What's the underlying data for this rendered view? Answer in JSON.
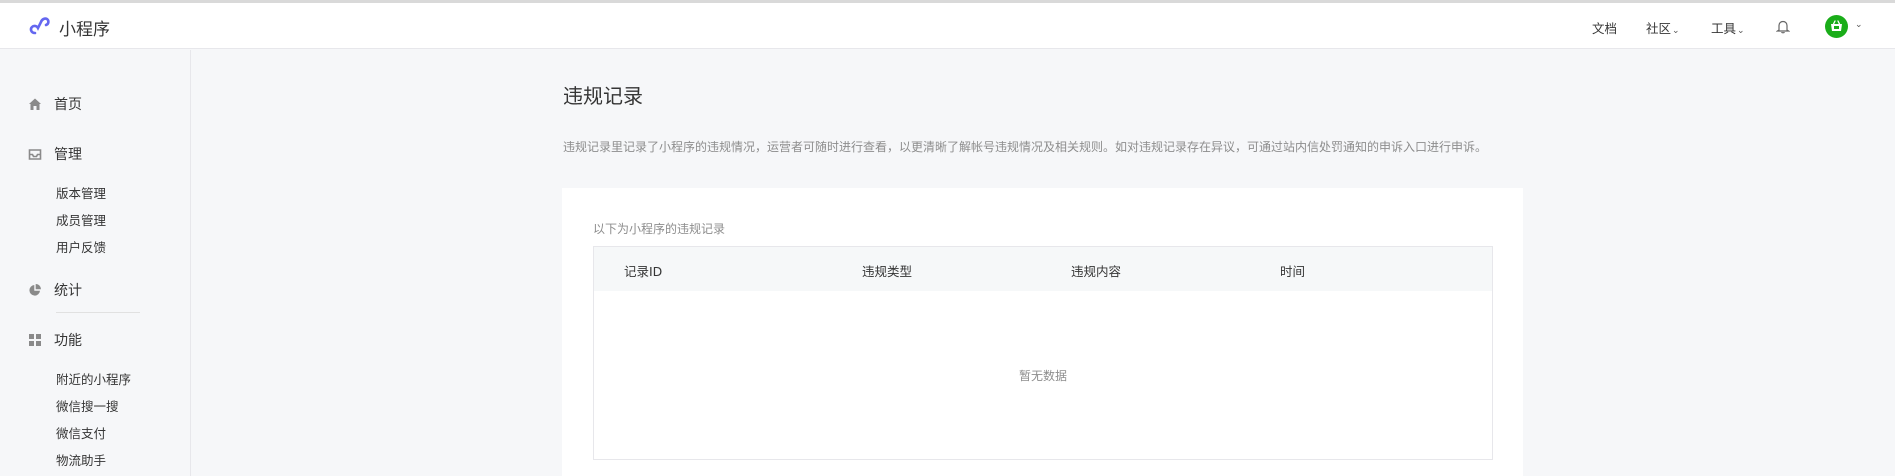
{
  "header": {
    "app_name": "小程序",
    "nav": {
      "docs": "文档",
      "community": "社区",
      "tools": "工具"
    },
    "icons": {
      "logo": "mini-program-logo-icon",
      "notifications": "bell-icon",
      "avatar": "shop-avatar-icon"
    },
    "accent_color": "#1aad19"
  },
  "sidebar": {
    "home": "首页",
    "manage": "管理",
    "manage_items": [
      "版本管理",
      "成员管理",
      "用户反馈"
    ],
    "stats": "统计",
    "features": "功能",
    "feature_items": [
      "附近的小程序",
      "微信搜一搜",
      "微信支付",
      "物流助手"
    ]
  },
  "main": {
    "title": "违规记录",
    "description": "违规记录里记录了小程序的违规情况，运营者可随时进行查看，以更清晰了解帐号违规情况及相关规则。如对违规记录存在异议，可通过站内信处罚通知的申诉入口进行申诉。",
    "panel_caption": "以下为小程序的违规记录",
    "table": {
      "columns": [
        "记录ID",
        "违规类型",
        "违规内容",
        "时间"
      ],
      "rows": [],
      "empty_text": "暂无数据"
    }
  }
}
